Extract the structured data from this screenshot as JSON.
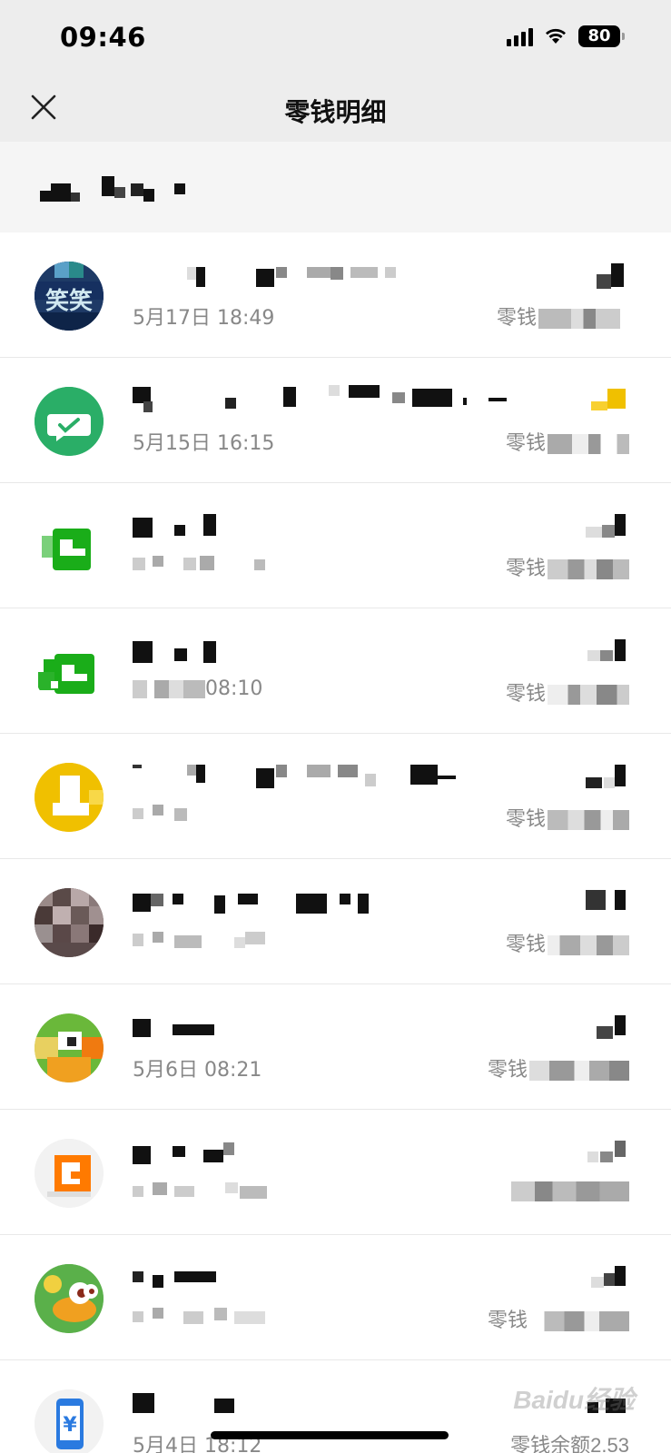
{
  "status_bar": {
    "time": "09:46",
    "battery": "80"
  },
  "nav": {
    "title": "零钱明细"
  },
  "transactions": [
    {
      "time": "5月17日 18:49",
      "balance_label": "零钱",
      "avatar": "avatar-laugh",
      "accent": "#2a4a7a"
    },
    {
      "time": "5月15日 16:15",
      "balance_label": "零钱",
      "avatar": "wechat-chat-icon",
      "accent": "#2aae67"
    },
    {
      "time": "",
      "balance_label": "零钱",
      "avatar": "wallet-icon",
      "accent": "#1aad19"
    },
    {
      "time": "08:10",
      "balance_label": "零钱",
      "avatar": "transfer-icon",
      "accent": "#1aad19"
    },
    {
      "time": "",
      "balance_label": "零钱",
      "avatar": "yellow-pay-icon",
      "accent": "#f0c000"
    },
    {
      "time": "",
      "balance_label": "零钱",
      "avatar": "photo-avatar",
      "accent": "#6a5a5a"
    },
    {
      "time": "5月6日 08:21",
      "balance_label": "零钱",
      "avatar": "cartoon-avatar",
      "accent": "#e87a1a"
    },
    {
      "time": "",
      "balance_label": "",
      "avatar": "orange-app-icon",
      "accent": "#ff7a00"
    },
    {
      "time": "",
      "balance_label": "零钱",
      "avatar": "duck-avatar",
      "accent": "#5ab04a"
    },
    {
      "time": "5月4日 18:12",
      "balance_label": "零钱余额",
      "avatar": "phone-pay-icon",
      "accent": "#2a7ae0"
    }
  ],
  "last_balance_value": "2.53",
  "watermark": "Baidu经验"
}
